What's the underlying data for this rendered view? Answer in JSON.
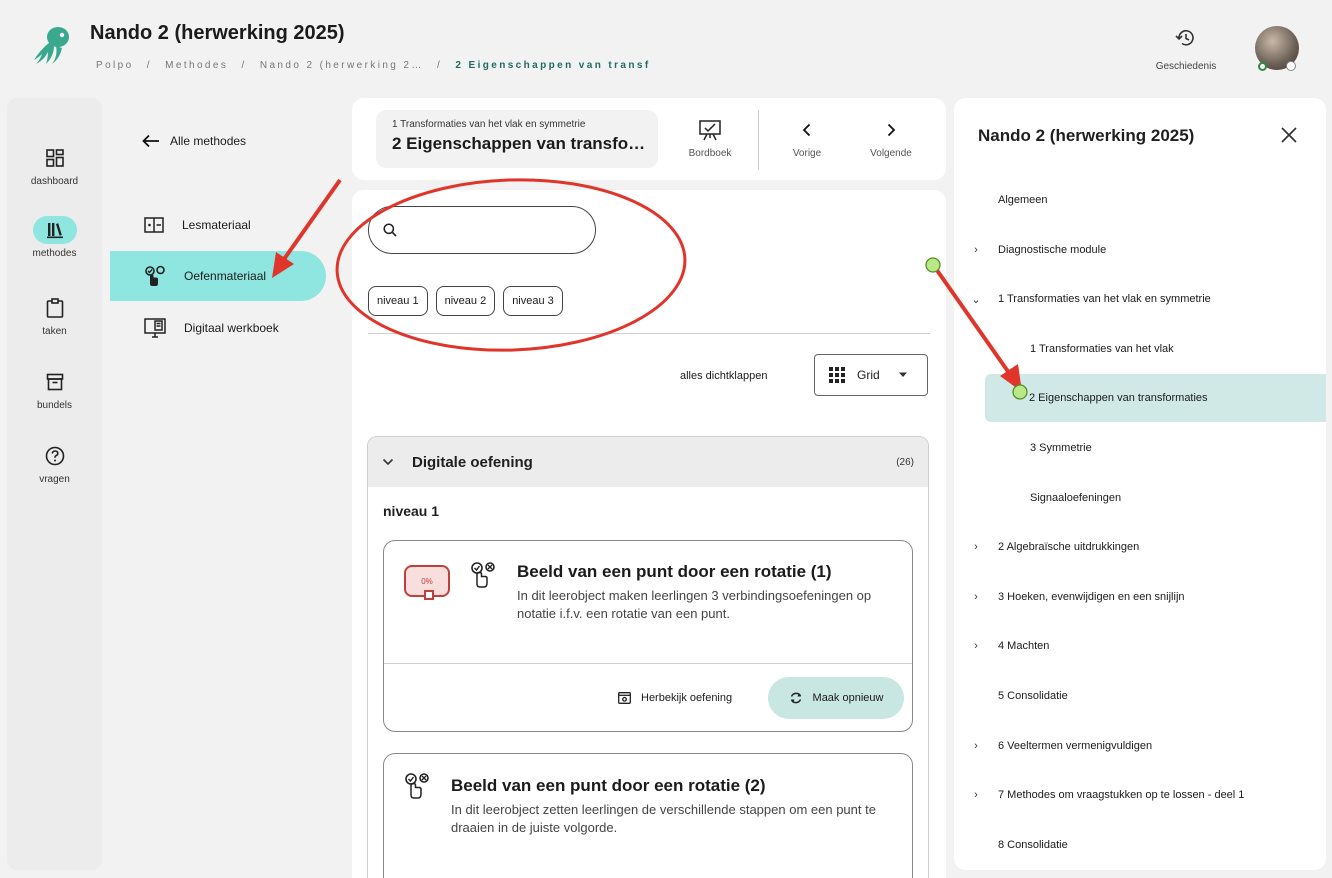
{
  "header": {
    "app_title": "Nando 2 (herwerking 2025)",
    "breadcrumb": [
      "Polpo",
      "Methodes",
      "Nando 2 (herwerking 2…",
      "2 Eigenschappen van transf"
    ],
    "breadcrumb_sep": "/",
    "history_label": "Geschiedenis"
  },
  "rail": {
    "items": [
      {
        "label": "dashboard",
        "icon": "dashboard-icon"
      },
      {
        "label": "methodes",
        "icon": "books-icon",
        "active": true
      },
      {
        "label": "taken",
        "icon": "clipboard-icon"
      },
      {
        "label": "bundels",
        "icon": "archive-icon"
      },
      {
        "label": "vragen",
        "icon": "question-icon"
      }
    ]
  },
  "nav2": {
    "back_label": "Alle methodes",
    "items": [
      {
        "label": "Lesmateriaal",
        "icon": "lesson-material-icon"
      },
      {
        "label": "Oefenmateriaal",
        "icon": "practice-material-icon",
        "active": true
      },
      {
        "label": "Digitaal werkboek",
        "icon": "digital-workbook-icon"
      }
    ]
  },
  "lesson": {
    "subtitle": "1 Transformaties van het vlak en symmetrie",
    "title": "2 Eigenschappen van transfo…",
    "bordboek": "Bordboek",
    "prev": "Vorige",
    "next": "Volgende"
  },
  "filters": {
    "search_placeholder": "",
    "chips": [
      "niveau 1",
      "niveau 2",
      "niveau 3"
    ],
    "collapse_all": "alles dichtklappen",
    "view_mode": "Grid"
  },
  "section": {
    "title": "Digitale oefening",
    "count": "(26)",
    "level": "niveau 1",
    "cards": [
      {
        "title": "Beeld van een punt door een rotatie (1)",
        "description": "In dit leerobject maken leerlingen 3 verbindingsoefeningen op notatie i.f.v. een rotatie van een punt.",
        "progress": "0%",
        "review_label": "Herbekijk oefening",
        "redo_label": "Maak opnieuw"
      },
      {
        "title": "Beeld van een punt door een rotatie (2)",
        "description": "In dit leerobject zetten leerlingen de verschillende stappen om een punt te draaien in de juiste volgorde."
      }
    ]
  },
  "panel": {
    "title": "Nando 2 (herwerking 2025)",
    "items": [
      {
        "label": "Algemeen",
        "level": 0,
        "chevron": ""
      },
      {
        "label": "Diagnostische module",
        "level": 0,
        "chevron": "›"
      },
      {
        "label": "1 Transformaties van het vlak en symmetrie",
        "level": 0,
        "chevron": "⌄"
      },
      {
        "label": "1 Transformaties van het vlak",
        "level": 1,
        "chevron": ""
      },
      {
        "label": "2 Eigenschappen van transformaties",
        "level": 1,
        "chevron": "",
        "active": true
      },
      {
        "label": "3 Symmetrie",
        "level": 1,
        "chevron": ""
      },
      {
        "label": "Signaaloefeningen",
        "level": 1,
        "chevron": ""
      },
      {
        "label": "2 Algebraïsche uitdrukkingen",
        "level": 0,
        "chevron": "›"
      },
      {
        "label": "3 Hoeken, evenwijdigen en een snijlijn",
        "level": 0,
        "chevron": "›"
      },
      {
        "label": "4 Machten",
        "level": 0,
        "chevron": "›"
      },
      {
        "label": "5 Consolidatie",
        "level": 0,
        "chevron": ""
      },
      {
        "label": "6 Veeltermen vermenigvuldigen",
        "level": 0,
        "chevron": "›"
      },
      {
        "label": "7 Methodes om vraagstukken op te lossen - deel 1",
        "level": 0,
        "chevron": "›"
      },
      {
        "label": "8 Consolidatie",
        "level": 0,
        "chevron": ""
      }
    ]
  },
  "colors": {
    "accent": "#8fe6e0",
    "active_tree": "#d1e9e6",
    "annotation_red": "#e0352b",
    "annotation_dot": "#b8e986"
  }
}
